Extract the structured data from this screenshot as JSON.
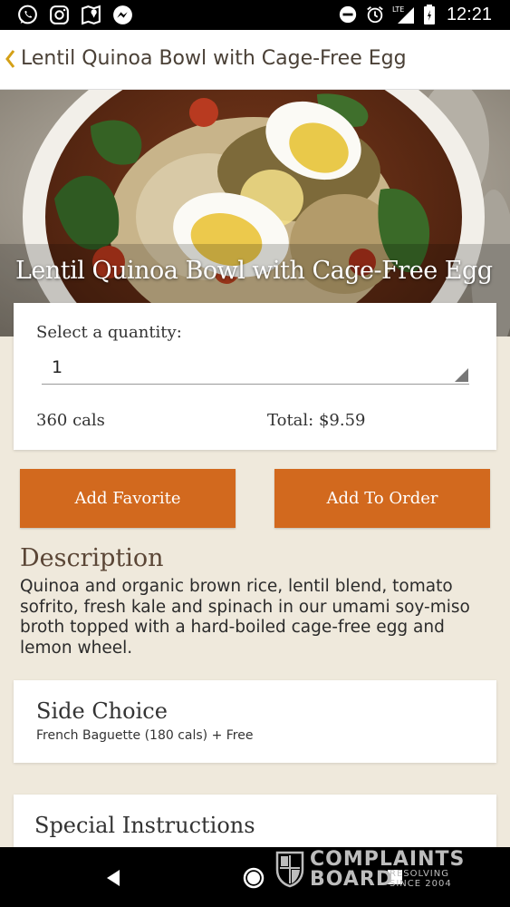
{
  "status_bar": {
    "time": "12:21",
    "icons": [
      "whatsapp-icon",
      "instagram-icon",
      "maps-icon",
      "messenger-icon",
      "do-not-disturb-icon",
      "alarm-icon",
      "lte-signal-icon",
      "battery-icon"
    ],
    "network_label": "LTE"
  },
  "app_bar": {
    "title": "Lentil Quinoa Bowl with Cage-Free Egg",
    "accent_color": "#d4a017"
  },
  "hero": {
    "title": "Lentil Quinoa Bowl with Cage-Free Egg"
  },
  "quantity": {
    "label": "Select a quantity:",
    "selected": "1",
    "calories": "360 cals",
    "total": "Total: $9.59"
  },
  "actions": {
    "add_favorite": "Add Favorite",
    "add_to_order": "Add To Order",
    "button_color": "#d2691e"
  },
  "description": {
    "heading": "Description",
    "body": "Quinoa and organic brown rice, lentil blend, tomato sofrito, fresh kale and spinach in our umami soy-miso broth topped with a hard-boiled cage-free egg and lemon wheel."
  },
  "side_choice": {
    "title": "Side Choice",
    "value": "French Baguette (180 cals) + Free"
  },
  "special_instructions": {
    "title": "Special Instructions"
  },
  "watermark": {
    "line1": "COMPLAINTS",
    "line2": "BOARD",
    "tag1": "RESOLVING",
    "tag2": "SINCE 2004"
  }
}
